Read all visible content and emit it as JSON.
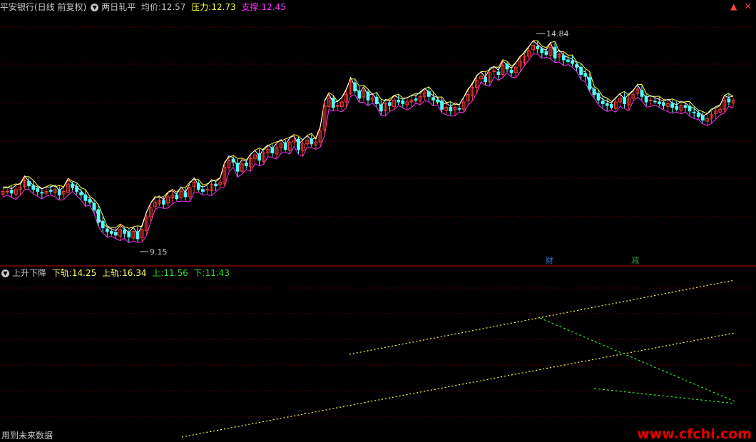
{
  "top_panel": {
    "stock_label": "平安银行(日线 前复权)",
    "indicator_name": "两日轧平",
    "avg_label": "均价:",
    "avg_value": "12.57",
    "pressure_label": "压力:",
    "pressure_value": "12.73",
    "support_label": "支撑:",
    "support_value": "12.45",
    "high_marker": "14.84",
    "low_marker": "9.15",
    "event_markers": [
      {
        "text": "财",
        "color": "#3a6fd8",
        "index": 126
      },
      {
        "text": "减",
        "color": "#2e9a3a",
        "index": 147
      }
    ]
  },
  "toolbar": {
    "down_icon": "▼",
    "up_icon": "▲",
    "close_icon": "✕",
    "settings_icon": "✕"
  },
  "bottom_panel": {
    "indicator_name": "上升下降",
    "lower_rail_label": "下轨:",
    "lower_rail_value": "14.25",
    "upper_rail_label": "上轨:",
    "upper_rail_value": "16.34",
    "up_label": "上:",
    "up_value": "11.56",
    "down_label": "下:",
    "down_value": "11.43"
  },
  "footer_text": "用到未来数据",
  "watermark": "www.cfchi.com",
  "colors": {
    "up": "#ff3a3a",
    "down": "#54ffff",
    "avg_line": "#ffff33",
    "pressure_line": "#ffffff",
    "support_line": "#ff33ff",
    "lower_rail": "#ffff66",
    "green_line": "#33dd33",
    "grid": "#8b0000"
  },
  "chart_data": {
    "type": "candlestick",
    "y_range": [
      8.8,
      15.4
    ],
    "closes": [
      10.55,
      10.55,
      10.5,
      10.6,
      10.65,
      10.85,
      10.7,
      10.6,
      10.55,
      10.5,
      10.55,
      10.55,
      10.6,
      10.45,
      10.55,
      10.75,
      10.65,
      10.55,
      10.45,
      10.3,
      10.25,
      10.05,
      9.7,
      9.55,
      9.45,
      9.4,
      9.35,
      9.5,
      9.4,
      9.3,
      9.45,
      9.25,
      9.5,
      9.85,
      10.1,
      10.25,
      10.3,
      10.2,
      10.4,
      10.45,
      10.35,
      10.55,
      10.4,
      10.65,
      10.8,
      10.6,
      10.55,
      10.6,
      10.75,
      10.7,
      10.8,
      11.2,
      11.4,
      11.35,
      11.1,
      11.3,
      11.25,
      11.45,
      11.55,
      11.4,
      11.6,
      11.7,
      11.6,
      11.75,
      11.85,
      11.7,
      11.9,
      11.95,
      11.7,
      11.85,
      11.95,
      11.85,
      11.9,
      12.2,
      12.9,
      13.1,
      12.85,
      12.9,
      13.0,
      13.2,
      13.55,
      13.3,
      13.1,
      13.3,
      13.05,
      13.1,
      12.95,
      12.75,
      12.95,
      12.9,
      13.05,
      13.0,
      12.95,
      13.0,
      13.05,
      13.05,
      13.15,
      13.25,
      13.15,
      13.05,
      13.0,
      12.8,
      12.85,
      12.75,
      12.85,
      12.8,
      13.0,
      13.2,
      13.4,
      13.6,
      13.7,
      13.55,
      13.8,
      13.85,
      13.75,
      14.0,
      13.9,
      13.8,
      13.95,
      14.1,
      14.25,
      14.4,
      14.55,
      14.45,
      14.35,
      14.3,
      14.5,
      14.2,
      14.3,
      14.15,
      14.1,
      14.05,
      13.95,
      13.75,
      13.7,
      13.35,
      13.2,
      13.05,
      12.95,
      12.9,
      12.85,
      13.0,
      13.1,
      12.95,
      13.1,
      13.2,
      13.35,
      13.15,
      13.0,
      13.05,
      13.0,
      12.95,
      12.9,
      12.95,
      12.85,
      12.8,
      12.9,
      12.85,
      12.75,
      12.7,
      12.6,
      12.5,
      12.55,
      12.65,
      12.75,
      12.8,
      13.05,
      13.0,
      13.05
    ]
  }
}
